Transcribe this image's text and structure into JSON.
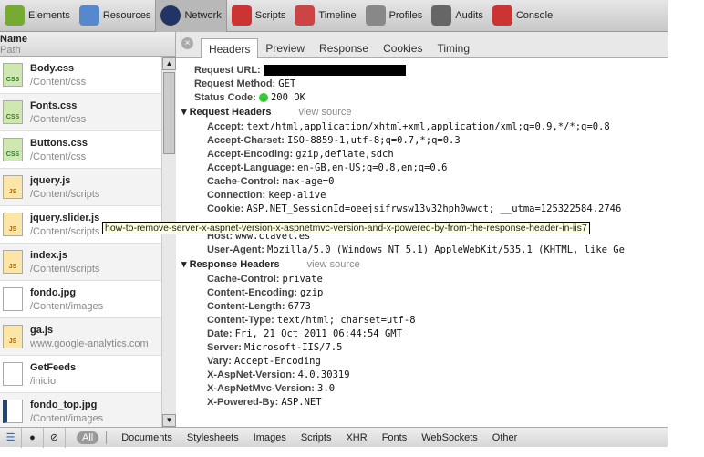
{
  "toolbar": [
    {
      "label": "Elements",
      "icon": "elements-icon",
      "color": "#7a3"
    },
    {
      "label": "Resources",
      "icon": "resources-icon",
      "color": "#58c"
    },
    {
      "label": "Network",
      "icon": "network-icon",
      "color": "#236",
      "selected": true
    },
    {
      "label": "Scripts",
      "icon": "scripts-icon",
      "color": "#c33"
    },
    {
      "label": "Timeline",
      "icon": "timeline-icon",
      "color": "#c44"
    },
    {
      "label": "Profiles",
      "icon": "profiles-icon",
      "color": "#888"
    },
    {
      "label": "Audits",
      "icon": "audits-icon",
      "color": "#666"
    },
    {
      "label": "Console",
      "icon": "console-icon",
      "color": "#c33"
    }
  ],
  "list": {
    "header_name": "Name",
    "header_path": "Path",
    "items": [
      {
        "name": "Body.css",
        "path": "/Content/css",
        "type": "CSS"
      },
      {
        "name": "Fonts.css",
        "path": "/Content/css",
        "type": "CSS"
      },
      {
        "name": "Buttons.css",
        "path": "/Content/css",
        "type": "CSS"
      },
      {
        "name": "jquery.js",
        "path": "/Content/scripts",
        "type": "JS"
      },
      {
        "name": "jquery.slider.js",
        "path": "/Content/scripts",
        "type": "JS"
      },
      {
        "name": "index.js",
        "path": "/Content/scripts",
        "type": "JS"
      },
      {
        "name": "fondo.jpg",
        "path": "/Content/images",
        "type": ""
      },
      {
        "name": "ga.js",
        "path": "www.google-analytics.com",
        "type": "JS"
      },
      {
        "name": "GetFeeds",
        "path": "/inicio",
        "type": ""
      },
      {
        "name": "fondo_top.jpg",
        "path": "/Content/images",
        "type": ""
      }
    ]
  },
  "tabs": [
    "Headers",
    "Preview",
    "Response",
    "Cookies",
    "Timing"
  ],
  "general": {
    "url_label": "Request URL:",
    "method_label": "Request Method:",
    "method": "GET",
    "status_label": "Status Code:",
    "status": "200 OK"
  },
  "request": {
    "title": "Request Headers",
    "view_source": "view source",
    "headers": [
      {
        "k": "Accept:",
        "v": "text/html,application/xhtml+xml,application/xml;q=0.9,*/*;q=0.8"
      },
      {
        "k": "Accept-Charset:",
        "v": "ISO-8859-1,utf-8;q=0.7,*;q=0.3"
      },
      {
        "k": "Accept-Encoding:",
        "v": "gzip,deflate,sdch"
      },
      {
        "k": "Accept-Language:",
        "v": "en-GB,en-US;q=0.8,en;q=0.6"
      },
      {
        "k": "Cache-Control:",
        "v": "max-age=0"
      },
      {
        "k": "Connection:",
        "v": "keep-alive"
      },
      {
        "k": "Cookie:",
        "v": "ASP.NET_SessionId=oeejsifrwsw13v32hph0wwct; __utma=125322584.2746"
      },
      {
        "k": "",
        "v": ""
      },
      {
        "k": "Host:",
        "v": "www.clavel.es"
      },
      {
        "k": "User-Agent:",
        "v": "Mozilla/5.0 (Windows NT 5.1) AppleWebKit/535.1 (KHTML, like Ge"
      }
    ]
  },
  "response": {
    "title": "Response Headers",
    "view_source": "view source",
    "headers": [
      {
        "k": "Cache-Control:",
        "v": "private"
      },
      {
        "k": "Content-Encoding:",
        "v": "gzip"
      },
      {
        "k": "Content-Length:",
        "v": "6773"
      },
      {
        "k": "Content-Type:",
        "v": "text/html; charset=utf-8"
      },
      {
        "k": "Date:",
        "v": "Fri, 21 Oct 2011 06:44:54 GMT"
      },
      {
        "k": "Server:",
        "v": "Microsoft-IIS/7.5"
      },
      {
        "k": "Vary:",
        "v": "Accept-Encoding"
      },
      {
        "k": "X-AspNet-Version:",
        "v": "4.0.30319"
      },
      {
        "k": "X-AspNetMvc-Version:",
        "v": "3.0"
      },
      {
        "k": "X-Powered-By:",
        "v": "ASP.NET"
      }
    ]
  },
  "tooltip": "how-to-remove-server-x-aspnet-version-x-aspnetmvc-version-and-x-powered-by-from-the-response-header-in-iis7",
  "filters": {
    "all": "All",
    "items": [
      "Documents",
      "Stylesheets",
      "Images",
      "Scripts",
      "XHR",
      "Fonts",
      "WebSockets",
      "Other"
    ]
  }
}
